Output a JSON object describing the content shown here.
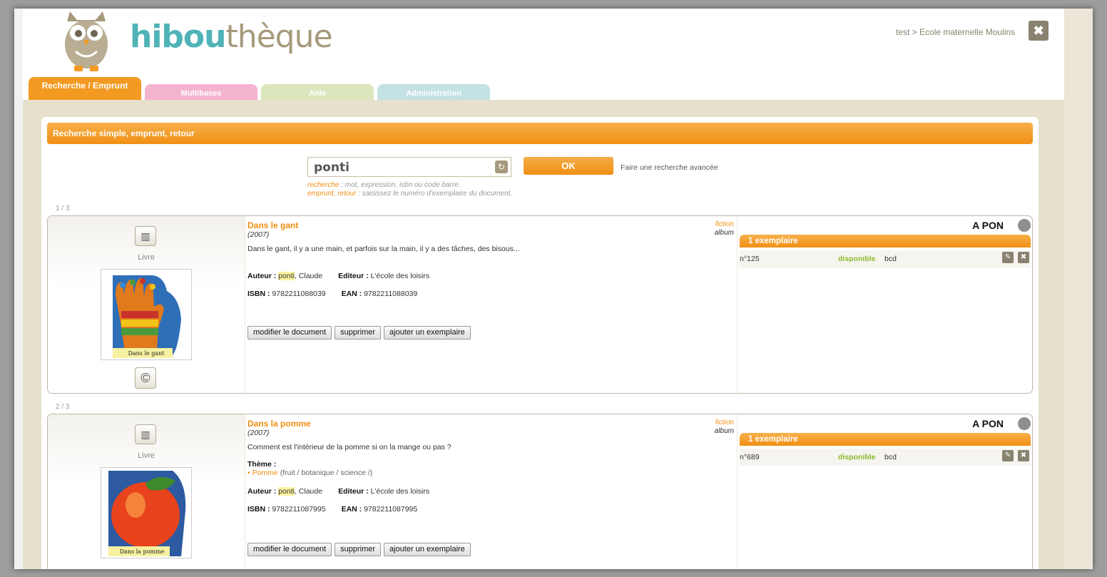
{
  "app": {
    "logo_part1": "hibou",
    "logo_part2": "thèque"
  },
  "header": {
    "breadcrumb": "test > Ecole maternelle Moulins"
  },
  "tabs": [
    {
      "label": "Recherche / Emprunt",
      "color": "#f39a22"
    },
    {
      "label": "Multibases",
      "color": "#f4b3cf"
    },
    {
      "label": "Aide",
      "color": "#dbe6bd"
    },
    {
      "label": "Administration",
      "color": "#c4e1e3"
    }
  ],
  "panel": {
    "title": "Recherche simple, emprunt, retour"
  },
  "search": {
    "value": "ponti",
    "ok_label": "OK",
    "advanced_link": "Faire une recherche avancée",
    "hint1_key": "recherche",
    "hint1_text": " : mot, expression, isbn ou code barre.",
    "hint2_key": "emprunt, retour",
    "hint2_text": " : saisissez le numéro d'exemplaire du document."
  },
  "labels": {
    "author": "Auteur :",
    "editor": "Editeur :",
    "isbn": "ISBN :",
    "ean": "EAN :",
    "theme": "Thème :",
    "modify": "modifier le document",
    "delete": "supprimer",
    "add_copy": "ajouter un exemplaire"
  },
  "results": [
    {
      "counter": "1 / 3",
      "type": "Livre",
      "title": "Dans le gant",
      "year": "(2007)",
      "genre": "fiction",
      "form": "album",
      "summary": "Dans le gant, il y a une main, et parfois sur la main, il y a des tâches, des bisous...",
      "author_hl": "ponti",
      "author_rest": ", Claude",
      "editor": "L'école des loisirs",
      "isbn": "9782211088039",
      "ean": "9782211088039",
      "cover_caption": "Dans le gant",
      "cote": "A PON",
      "copies_label": "1 exemplaire",
      "copy": {
        "number": "n°125",
        "status": "disponible",
        "location": "bcd"
      }
    },
    {
      "counter": "2 / 3",
      "type": "Livre",
      "title": "Dans la pomme",
      "year": "(2007)",
      "genre": "fiction",
      "form": "album",
      "summary": "Comment est l'intérieur de la pomme si on la mange ou pas ?",
      "theme_bullet": "• ",
      "theme_name": "Pomme",
      "theme_path": " (fruit / botanique / science /)",
      "author_hl": "ponti",
      "author_rest": ", Claude",
      "editor": "L'école des loisirs",
      "isbn": "9782211087995",
      "ean": "9782211087995",
      "cover_caption": "Dans la pomme",
      "cote": "A PON",
      "copies_label": "1 exemplaire",
      "copy": {
        "number": "n°689",
        "status": "disponible",
        "location": "bcd"
      }
    }
  ]
}
